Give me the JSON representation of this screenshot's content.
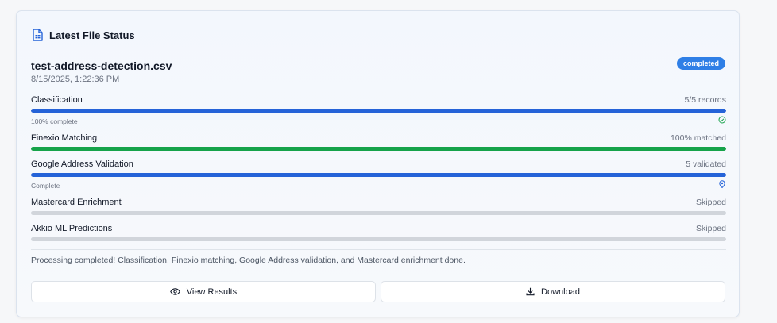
{
  "header": {
    "title": "Latest File Status",
    "icon": "document-icon"
  },
  "file": {
    "name": "test-address-detection.csv",
    "timestamp": "8/15/2025, 1:22:36 PM",
    "status": "completed"
  },
  "steps": [
    {
      "label": "Classification",
      "value": "5/5 records",
      "progress": 1.0,
      "color": "#2563d8",
      "sub": "100% complete",
      "sub_icon": "check-circle-icon"
    },
    {
      "label": "Finexio Matching",
      "value": "100% matched",
      "progress": 1.0,
      "color": "#16a34a"
    },
    {
      "label": "Google Address Validation",
      "value": "5 validated",
      "progress": 1.0,
      "color": "#2563d8",
      "sub": "Complete",
      "sub_icon": "map-pin-icon"
    },
    {
      "label": "Mastercard Enrichment",
      "value": "Skipped",
      "progress": 0,
      "color": "#d1d5db"
    },
    {
      "label": "Akkio ML Predictions",
      "value": "Skipped",
      "progress": 0,
      "color": "#d1d5db"
    }
  ],
  "message": "Processing completed! Classification, Finexio matching, Google Address validation, and Mastercard enrichment done.",
  "actions": {
    "view_results": "View Results",
    "download": "Download"
  },
  "colors": {
    "accent": "#2f7fe6",
    "success": "#16a34a",
    "progress_blue": "#2563d8"
  }
}
